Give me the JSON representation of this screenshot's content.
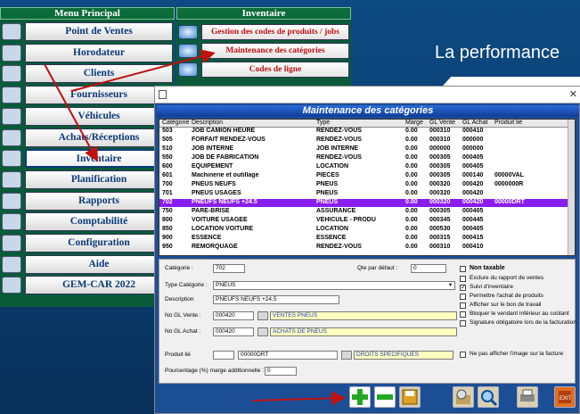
{
  "menu": {
    "title": "Menu Principal",
    "items": [
      {
        "label": "Point de Ventes",
        "icon": "pos-icon"
      },
      {
        "label": "Horodateur",
        "icon": "clock-card-icon"
      },
      {
        "label": "Clients",
        "icon": "client-icon"
      },
      {
        "label": "Fournisseurs",
        "icon": "supplier-icon"
      },
      {
        "label": "Véhicules",
        "icon": "vehicle-icon"
      },
      {
        "label": "Achats/Réceptions",
        "icon": "purchase-icon"
      },
      {
        "label": "Inventaire",
        "icon": "inventory-icon"
      },
      {
        "label": "Planification",
        "icon": "planning-icon"
      },
      {
        "label": "Rapports",
        "icon": "report-icon"
      },
      {
        "label": "Comptabilité",
        "icon": "accounting-icon"
      },
      {
        "label": "Configuration",
        "icon": "config-icon"
      },
      {
        "label": "Aide",
        "icon": "help-icon"
      },
      {
        "label": "GEM-CAR 2022",
        "icon": "gemcar-logo-icon"
      }
    ]
  },
  "inventory": {
    "title": "Inventaire",
    "items": [
      "Gestion des codes de produits / jobs",
      "Maintenance des catégories",
      "Codes de ligne"
    ]
  },
  "brand": {
    "tagline": "La performance"
  },
  "dialog": {
    "title": "Maintenance des catégories",
    "columns": [
      "Catégorie",
      "Description",
      "Type",
      "Marge",
      "GL Vente",
      "GL Achat",
      "Produit lié"
    ],
    "rows": [
      [
        "503",
        "JOB CAMION HEURE",
        "RENDEZ-VOUS",
        "0.00",
        "000310",
        "000410",
        ""
      ],
      [
        "505",
        "FORFAIT RENDEZ-VOUS",
        "RENDEZ-VOUS",
        "0.00",
        "000310",
        "000000",
        ""
      ],
      [
        "510",
        "JOB INTERNE",
        "JOB INTERNE",
        "0.00",
        "000000",
        "000000",
        ""
      ],
      [
        "550",
        "JOB DE FABRICATION",
        "RENDEZ-VOUS",
        "0.00",
        "000305",
        "000405",
        ""
      ],
      [
        "600",
        "ÉQUIPEMENT",
        "LOCATION",
        "0.00",
        "000305",
        "000405",
        ""
      ],
      [
        "601",
        "Machinerie et outillage",
        "PIÈCES",
        "0.00",
        "000305",
        "000140",
        "00000VAL"
      ],
      [
        "700",
        "PNEUS NEUFS",
        "PNEUS",
        "0.00",
        "000320",
        "000420",
        "0000000R"
      ],
      [
        "701",
        "PNEUS USAGÉS",
        "PNEUS",
        "0.00",
        "000320",
        "000420",
        ""
      ],
      [
        "702",
        "PNEUFS NEUFS +24.5",
        "PNEUS",
        "0.00",
        "000320",
        "000420",
        "00000DRT"
      ],
      [
        "750",
        "PARE-BRISE",
        "ASSURANCE",
        "0.00",
        "000305",
        "000405",
        ""
      ],
      [
        "800",
        "VOITURE USAGÉE",
        "VÉHICULE - PRODU",
        "0.00",
        "000345",
        "000445",
        ""
      ],
      [
        "850",
        "LOCATION VOITURE",
        "LOCATION",
        "0.00",
        "000530",
        "000405",
        ""
      ],
      [
        "900",
        "ESSENCE",
        "ESSENCE",
        "0.00",
        "000315",
        "000415",
        ""
      ],
      [
        "950",
        "REMORQUAGE",
        "RENDEZ-VOUS",
        "0.00",
        "000310",
        "000410",
        ""
      ]
    ],
    "selected_row": 8,
    "form": {
      "categorie_label": "Catégorie :",
      "categorie": "702",
      "qte_label": "Qte par défaut :",
      "qte": "0",
      "type_label": "Type Catégorie :",
      "type": "PNEUS",
      "desc_label": "Description",
      "desc": "PNEUFS NEUFS +24.5",
      "glv_label": "No GL Vente :",
      "glv": "000420",
      "glv_desc": "VENTES PNEUS",
      "gla_label": "No GL Achat :",
      "gla": "000420",
      "gla_desc": "ACHATS DE PNEUS",
      "prod_label": "Produit lié",
      "prod_code": "00000DRT",
      "prod_desc": "DROITS SPÉCIFIQUES",
      "pct_label": "Pourcentage (%) marge additionnelle :",
      "pct": "0",
      "checks": [
        {
          "label": "Non taxable",
          "checked": false,
          "bold": true
        },
        {
          "label": "Exclure du rapport de ventes",
          "checked": false
        },
        {
          "label": "Suivi d'inventaire",
          "checked": true
        },
        {
          "label": "Permettre l'achat de produits",
          "checked": false
        },
        {
          "label": "Afficher sur le bon de travail",
          "checked": false
        },
        {
          "label": "Bloquer le vendant inférieur au coûtant",
          "checked": false
        },
        {
          "label": "Signature obligatoire lors de la facturation",
          "checked": false
        }
      ],
      "no_image_label": "Ne pas afficher l'image sur la facture"
    }
  }
}
